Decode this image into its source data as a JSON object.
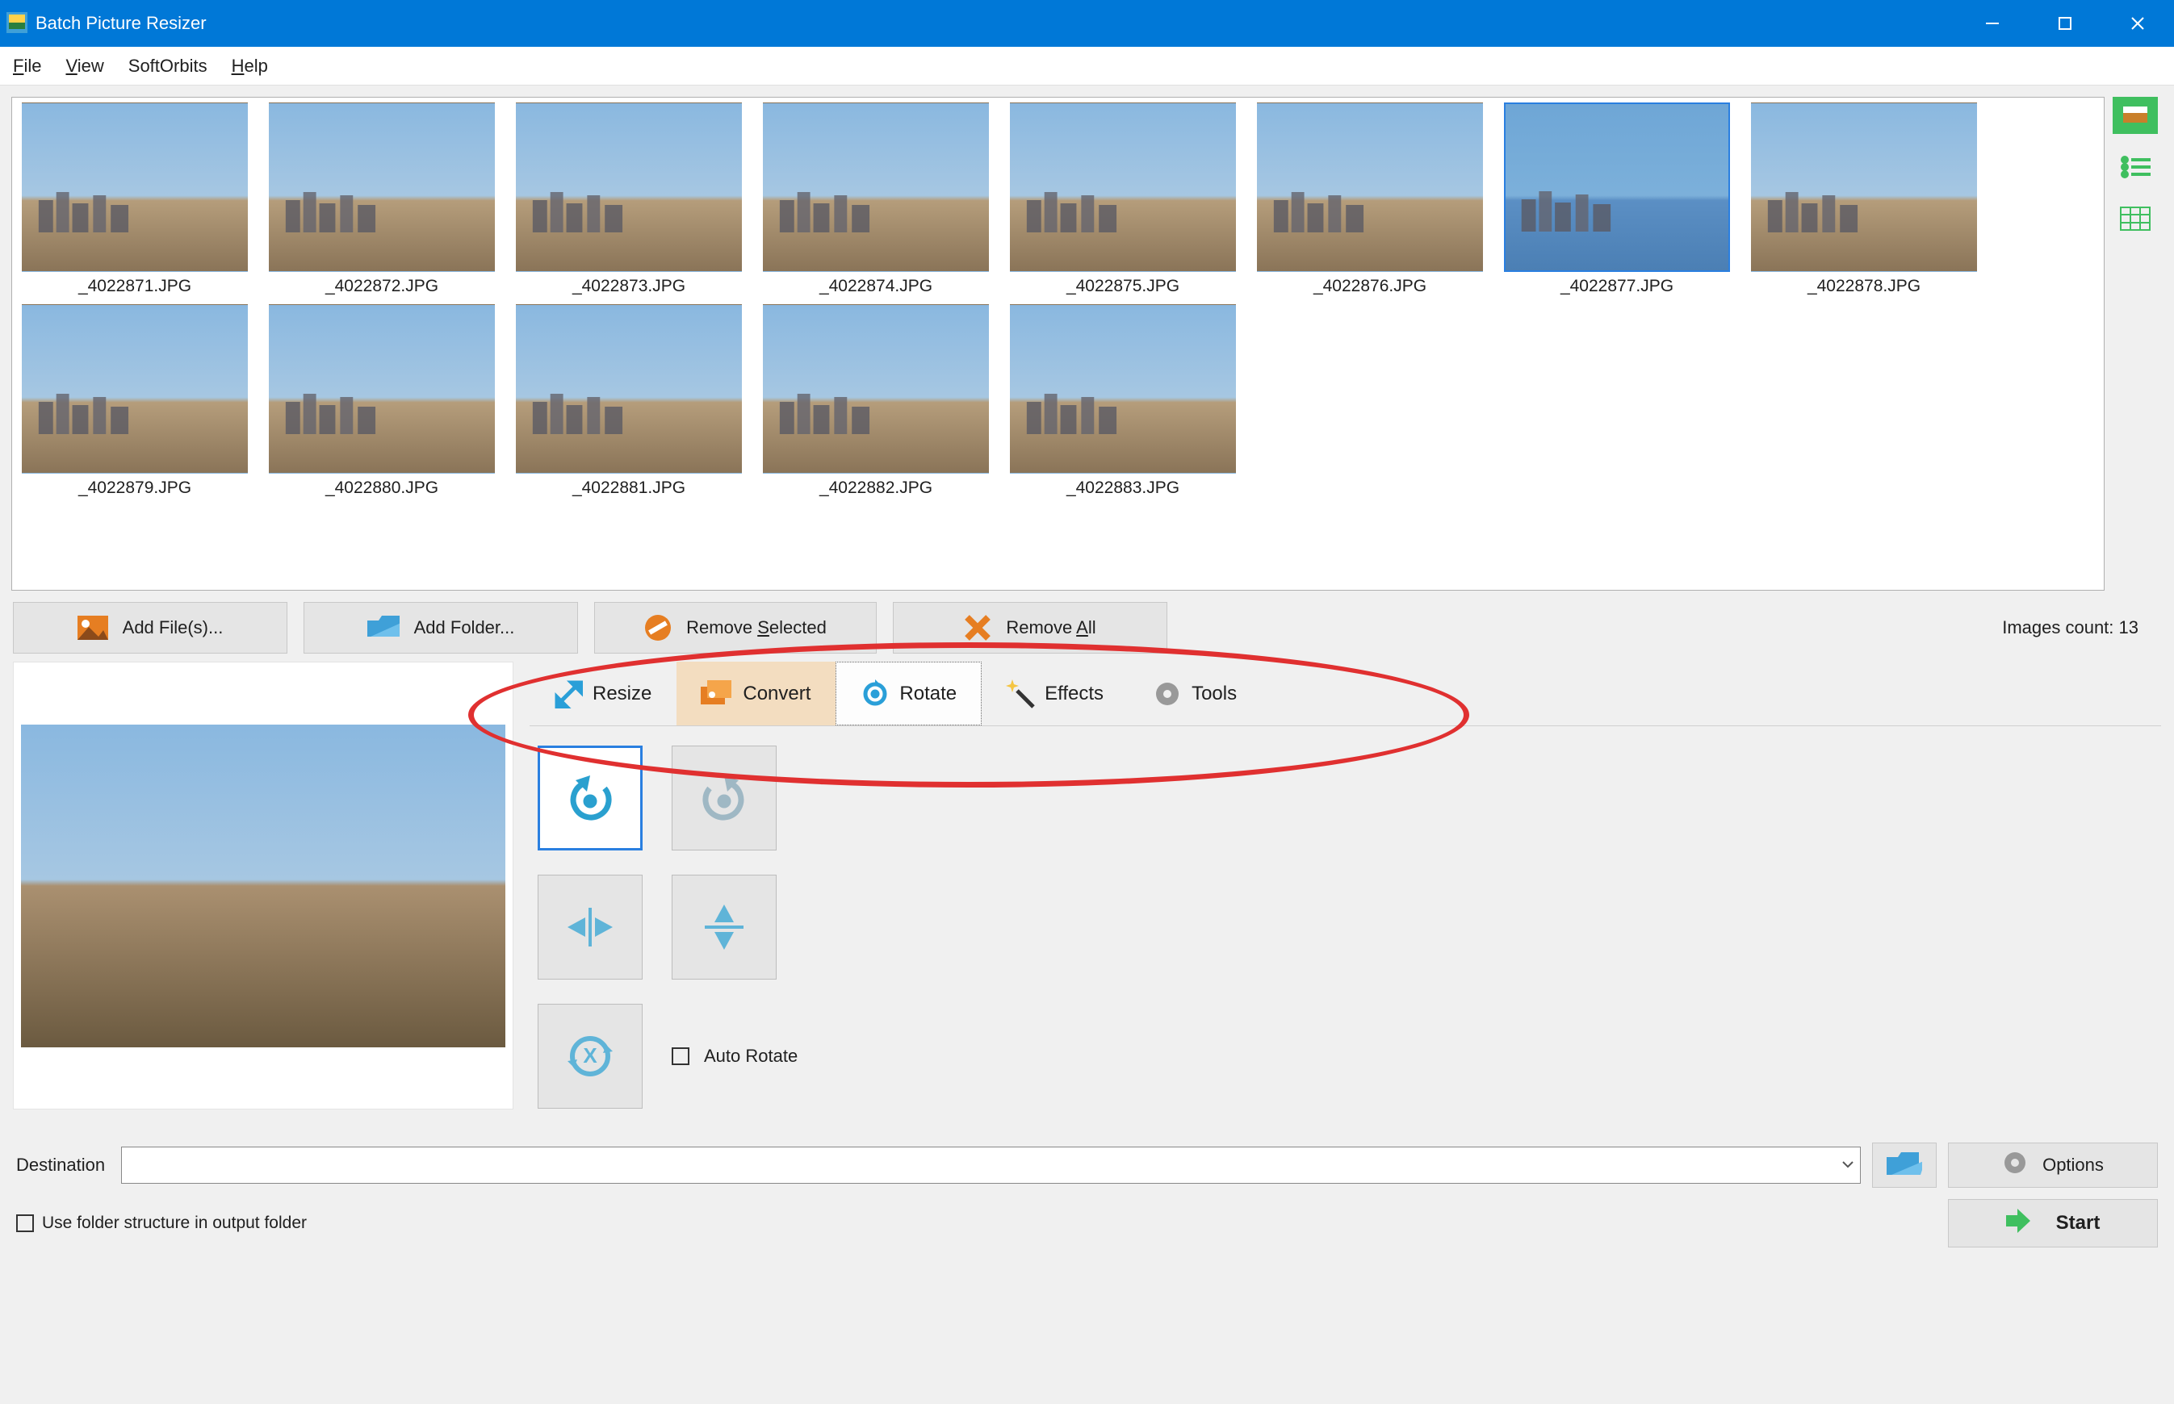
{
  "app": {
    "title": "Batch Picture Resizer"
  },
  "menu": {
    "file": "File",
    "view": "View",
    "softorbits": "SoftOrbits",
    "help": "Help"
  },
  "thumbs": [
    {
      "label": "_4022871.JPG"
    },
    {
      "label": "_4022872.JPG"
    },
    {
      "label": "_4022873.JPG"
    },
    {
      "label": "_4022874.JPG"
    },
    {
      "label": "_4022875.JPG"
    },
    {
      "label": "_4022876.JPG"
    },
    {
      "label": "_4022877.JPG",
      "selected": true
    },
    {
      "label": "_4022878.JPG"
    },
    {
      "label": "_4022879.JPG"
    },
    {
      "label": "_4022880.JPG"
    },
    {
      "label": "_4022881.JPG"
    },
    {
      "label": "_4022882.JPG"
    },
    {
      "label": "_4022883.JPG"
    }
  ],
  "filebar": {
    "add_files": "Add File(s)...",
    "add_folder": "Add Folder...",
    "remove_selected": "Remove Selected",
    "remove_all": "Remove All",
    "images_count": "Images count: 13"
  },
  "tabs": {
    "resize": "Resize",
    "convert": "Convert",
    "rotate": "Rotate",
    "effects": "Effects",
    "tools": "Tools",
    "active": "rotate"
  },
  "rotate": {
    "auto_rotate": "Auto Rotate",
    "auto_rotate_checked": false
  },
  "bottom": {
    "destination_label": "Destination",
    "destination_value": "",
    "use_folder_structure": "Use folder structure in output folder",
    "use_folder_structure_checked": false,
    "options": "Options",
    "start": "Start"
  }
}
